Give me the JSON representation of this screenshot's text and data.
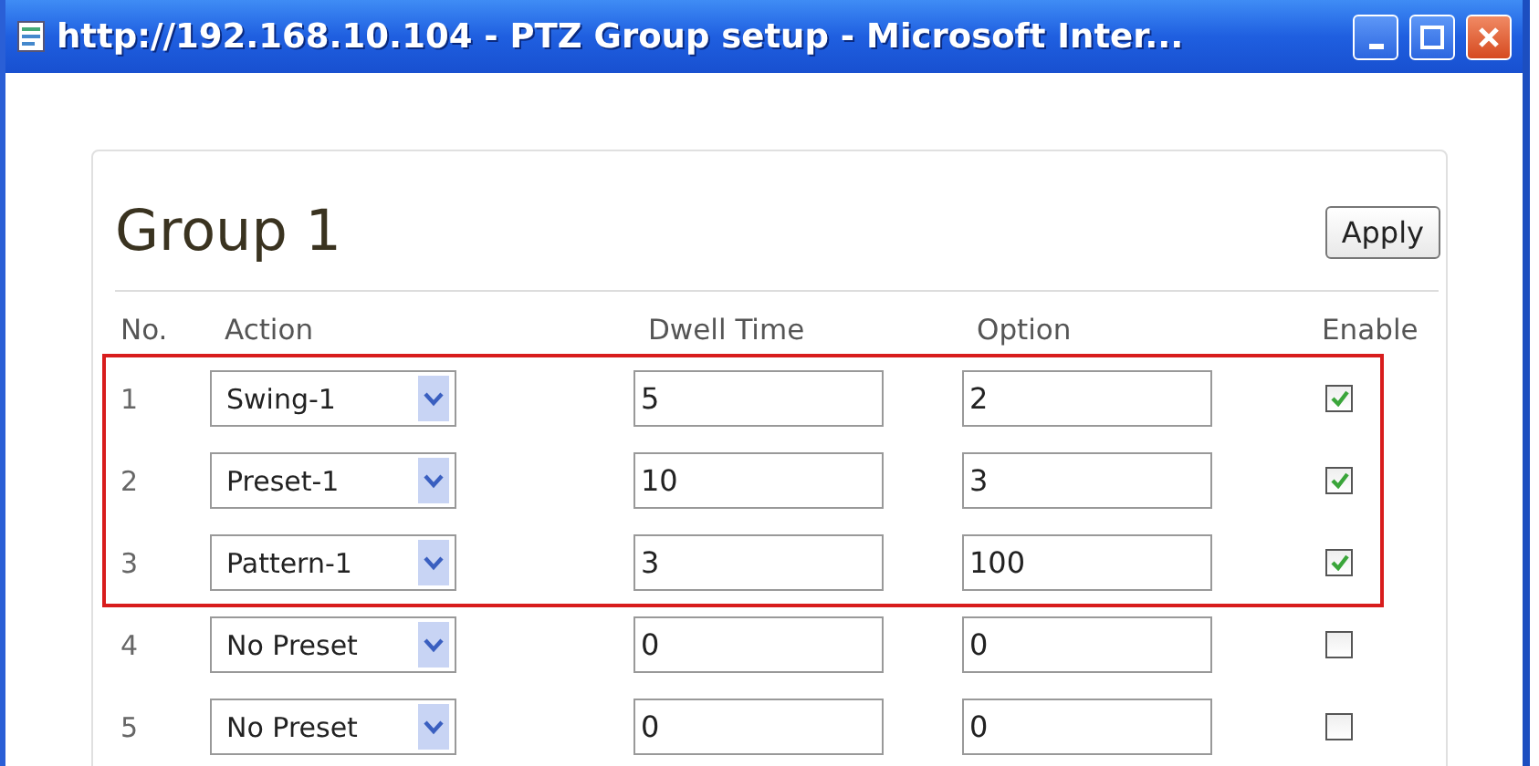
{
  "window": {
    "title": "http://192.168.10.104 - PTZ Group setup - Microsoft Inter..."
  },
  "group": {
    "title": "Group 1",
    "apply_button": "Apply"
  },
  "table": {
    "columns": [
      "No.",
      "Action",
      "Dwell Time",
      "Option",
      "Enable"
    ],
    "rows": [
      {
        "no": "1",
        "action": "Swing-1",
        "dwell_time": "5",
        "option": "2",
        "enable": true,
        "highlighted": true
      },
      {
        "no": "2",
        "action": "Preset-1",
        "dwell_time": "10",
        "option": "3",
        "enable": true,
        "highlighted": true
      },
      {
        "no": "3",
        "action": "Pattern-1",
        "dwell_time": "3",
        "option": "100",
        "enable": true,
        "highlighted": true
      },
      {
        "no": "4",
        "action": "No Preset",
        "dwell_time": "0",
        "option": "0",
        "enable": false,
        "highlighted": false
      },
      {
        "no": "5",
        "action": "No Preset",
        "dwell_time": "0",
        "option": "0",
        "enable": false,
        "highlighted": false
      }
    ]
  }
}
